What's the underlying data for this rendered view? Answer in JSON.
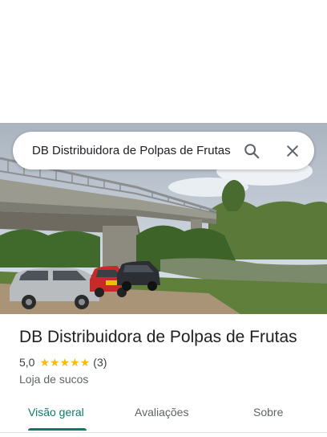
{
  "search": {
    "query": "DB Distribuidora de Polpas de Frutas",
    "search_icon": "search-icon",
    "close_icon": "close-icon"
  },
  "place": {
    "photo": "place-photo",
    "name": "DB Distribuidora de Polpas de Frutas",
    "rating": "5,0",
    "stars": 5,
    "review_count": "(3)",
    "category": "Loja de sucos"
  },
  "tabs": [
    {
      "label": "Visão geral",
      "active": true
    },
    {
      "label": "Avaliações",
      "active": false
    },
    {
      "label": "Sobre",
      "active": false
    }
  ],
  "colors": {
    "accent": "#0b7a6f",
    "star": "#fbbc04"
  }
}
